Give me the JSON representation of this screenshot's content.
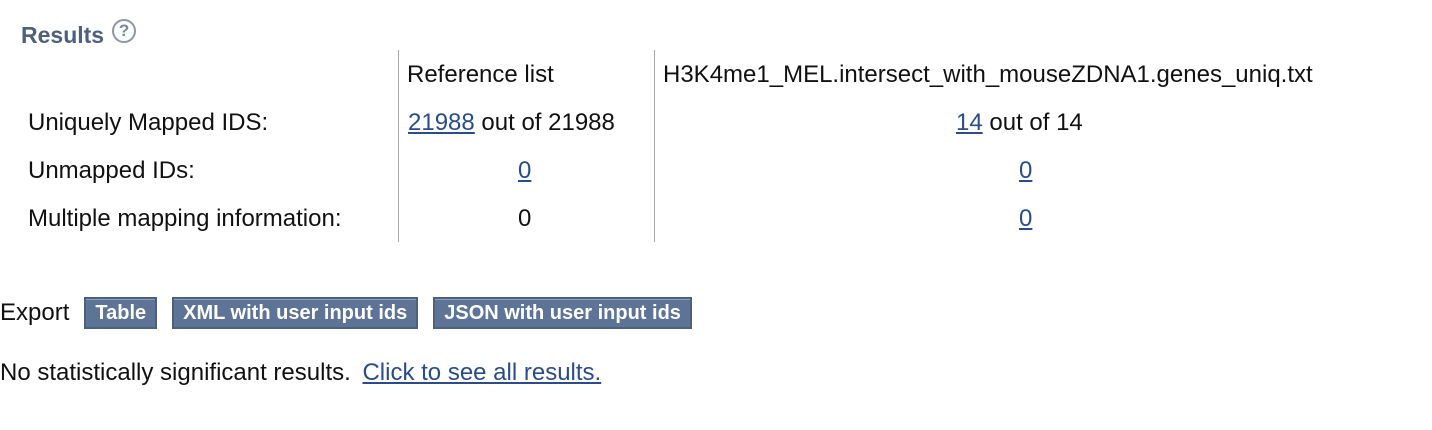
{
  "results": {
    "title": "Results",
    "help_icon_glyph": "?"
  },
  "table": {
    "headers": [
      "",
      "Reference list",
      "H3K4me1_MEL.intersect_with_mouseZDNA1.genes_uniq.txt"
    ],
    "rows": [
      {
        "label": "Uniquely Mapped IDS:",
        "reference": {
          "link": "21988",
          "suffix": " out of 21988"
        },
        "user_list": {
          "link": "14",
          "suffix": " out of 14"
        }
      },
      {
        "label": "Unmapped IDs:",
        "reference": {
          "link": "0",
          "suffix": ""
        },
        "user_list": {
          "link": "0",
          "suffix": ""
        }
      },
      {
        "label": "Multiple mapping information:",
        "reference": {
          "text": "0"
        },
        "user_list": {
          "link": "0",
          "suffix": ""
        }
      }
    ]
  },
  "export": {
    "label": "Export",
    "buttons": [
      "Table",
      "XML with user input ids",
      "JSON with user input ids"
    ]
  },
  "message": {
    "text": "No statistically significant results.",
    "link": "Click to see all results."
  },
  "colors": {
    "header_blue": "#4d6080",
    "link_blue": "#2a4d89",
    "button_blue": "#5d7496"
  }
}
